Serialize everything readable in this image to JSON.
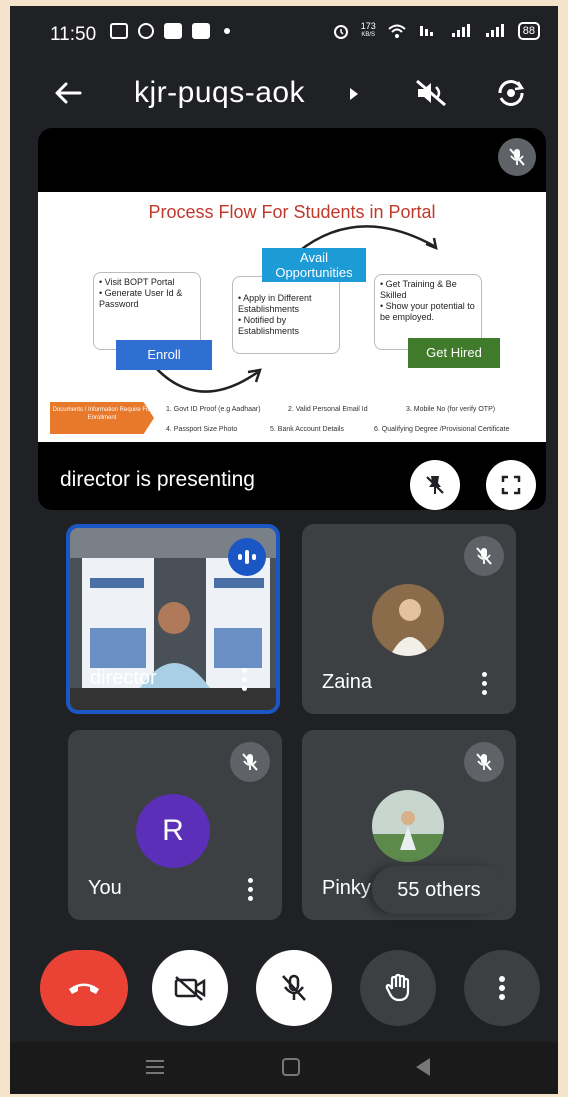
{
  "status_bar": {
    "time": "11:50",
    "speed_value": "173",
    "speed_unit": "KB/S",
    "battery": "88"
  },
  "header": {
    "meeting_code": "kjr-puqs-aok"
  },
  "presentation": {
    "label": "director is presenting",
    "slide": {
      "title": "Process Flow For Students in Portal",
      "box1_items": [
        "Visit BOPT Portal",
        "Generate User Id & Password"
      ],
      "box2_items": [
        "Apply in Different Establishments",
        "Notified by Establishments"
      ],
      "box3_items": [
        "Get Training & Be Skilled",
        "Show your potential to be employed."
      ],
      "enroll": "Enroll",
      "avail": "Avail Opportunities",
      "hired": "Get Hired",
      "docs_tag": "Documents / Information Require For Enrollment",
      "docs": [
        "1. Govt ID Proof (e.g Aadhaar)",
        "2. Valid Personal Email Id",
        "3. Mobile No (for verify OTP)",
        "4. Passport Size Photo",
        "5. Bank Account Details",
        "6. Qualifying Degree /Provisional Certificate"
      ]
    }
  },
  "participants": {
    "director": {
      "name": "director"
    },
    "zaina": {
      "name": "Zaina"
    },
    "you": {
      "name": "You",
      "initial": "R"
    },
    "pinky": {
      "name": "Pinky"
    },
    "others": "55 others"
  },
  "icons": {
    "back": "arrow-left-icon",
    "audio": "audio-off-icon",
    "switch_camera": "switch-camera-icon",
    "mic_off": "mic-off-icon",
    "unpin": "unpin-icon",
    "fullscreen": "fullscreen-icon",
    "end_call": "end-call-icon",
    "camera_off": "camera-off-icon",
    "raise_hand": "hand-icon",
    "more": "more-vert-icon"
  },
  "colors": {
    "end_call": "#ea4335",
    "active_speaker": "#1a56c4",
    "avatar": "#5b2fb8",
    "background": "#202124"
  }
}
